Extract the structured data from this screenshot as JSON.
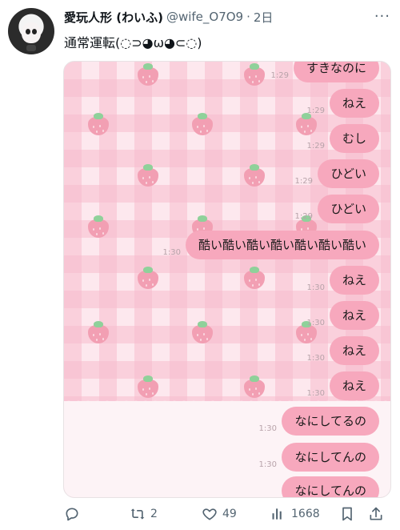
{
  "post": {
    "display_name": "愛玩人形 (わいふ)",
    "handle": "@wife_O7O9",
    "separator": "·",
    "time": "2日",
    "more_label": "···",
    "text": "通常運転(◌⊃◕ω◕⊂◌)"
  },
  "media": {
    "messages": [
      {
        "text": "すきなのに",
        "time": "1:29"
      },
      {
        "text": "ねえ",
        "time": "1:29"
      },
      {
        "text": "むし",
        "time": "1:29"
      },
      {
        "text": "ひどい",
        "time": "1:29"
      },
      {
        "text": "ひどい",
        "time": "1:29"
      },
      {
        "text": "酷い酷い酷い酷い酷い酷い酷い",
        "time": "1:30"
      },
      {
        "text": "ねえ",
        "time": "1:30"
      },
      {
        "text": "ねえ",
        "time": "1:30"
      },
      {
        "text": "ねえ",
        "time": "1:30"
      },
      {
        "text": "ねえ",
        "time": "1:30"
      },
      {
        "text": "なにしてるの",
        "time": "1:30"
      },
      {
        "text": "なにしてんの",
        "time": "1:30"
      },
      {
        "text": "なにしてんの",
        "time": ""
      }
    ]
  },
  "actions": {
    "reply_icon": "reply-icon",
    "retweet_icon": "retweet-icon",
    "retweet_count": "2",
    "like_icon": "heart-icon",
    "like_count": "49",
    "views_icon": "views-bar-icon",
    "views_count": "1668",
    "bookmark_icon": "bookmark-icon",
    "share_icon": "share-icon"
  },
  "colors": {
    "bubble": "#f7a8bd",
    "check_pink": "#fde8ee",
    "secondary_text": "#536471"
  }
}
